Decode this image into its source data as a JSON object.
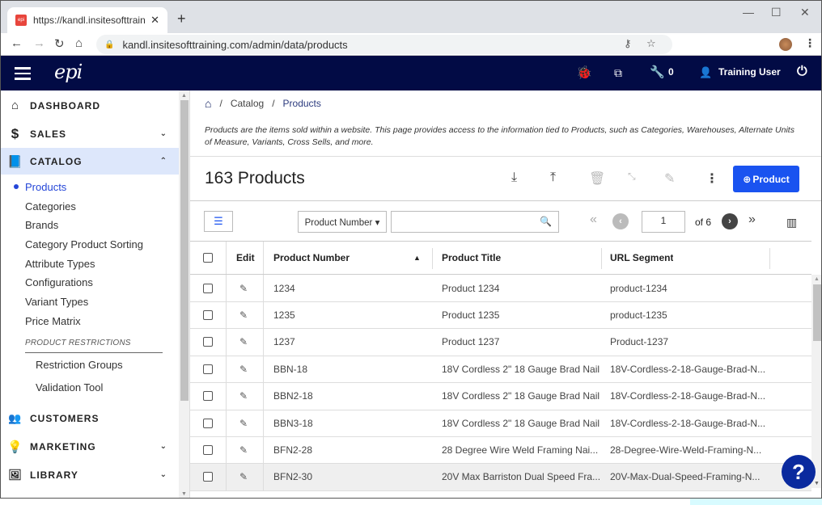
{
  "browser": {
    "tab_title": "https://kandl.insitesofttraining.com",
    "url": "kandl.insitesofttraining.com/admin/data/products",
    "icons": {
      "back": "arrow-left",
      "forward": "arrow-right",
      "reload": "reload",
      "home": "home",
      "lock": "lock",
      "key": "key",
      "star": "star",
      "minimize": "minimize",
      "maximize": "maximize",
      "close": "close"
    }
  },
  "topbar": {
    "logo": "epi",
    "wrench_count": "0",
    "user_name": "Training User",
    "icons": [
      "bug-icon",
      "open-external-icon",
      "wrench-icon",
      "user-icon",
      "power-icon"
    ]
  },
  "sidebar": {
    "sections": [
      {
        "label": "DASHBOARD",
        "icon": "home"
      },
      {
        "label": "SALES",
        "icon": "dollar",
        "chevron": "down"
      },
      {
        "label": "CATALOG",
        "icon": "book",
        "chevron": "up",
        "active": true
      },
      {
        "label": "CUSTOMERS",
        "icon": "people"
      },
      {
        "label": "MARKETING",
        "icon": "lightbulb",
        "chevron": "down"
      },
      {
        "label": "LIBRARY",
        "icon": "photo-library",
        "chevron": "down"
      }
    ],
    "catalog_items": [
      "Products",
      "Categories",
      "Brands",
      "Category Product Sorting",
      "Attribute Types",
      "Configurations",
      "Variant Types",
      "Price Matrix"
    ],
    "group_label": "PRODUCT RESTRICTIONS",
    "group_items": [
      "Restriction Groups",
      "Validation Tool"
    ]
  },
  "main": {
    "breadcrumb": {
      "sep": "/",
      "items": [
        "Catalog",
        "Products"
      ]
    },
    "description": "Products are the items sold within a website. This page provides access to the information tied to Products, such as Categories, Warehouses, Alternate Units of Measure, Variants, Cross Sells, and more.",
    "title": "163 Products",
    "add_button": "Product",
    "filter": {
      "field": "Product Number ▾",
      "search_value": ""
    },
    "pagination": {
      "page": "1",
      "of_label": "of 6"
    },
    "table": {
      "headers": {
        "edit": "Edit",
        "product_number": "Product Number",
        "product_title": "Product Title",
        "url_segment": "URL Segment"
      },
      "rows": [
        {
          "number": "1234",
          "title": "Product 1234",
          "url": "product-1234"
        },
        {
          "number": "1235",
          "title": "Product 1235",
          "url": "product-1235"
        },
        {
          "number": "1237",
          "title": "Product 1237",
          "url": "Product-1237"
        },
        {
          "number": "BBN-18",
          "title": "18V Cordless 2\" 18 Gauge Brad Nail...",
          "url": "18V-Cordless-2-18-Gauge-Brad-N..."
        },
        {
          "number": "BBN2-18",
          "title": "18V Cordless 2\" 18 Gauge Brad Nail...",
          "url": "18V-Cordless-2-18-Gauge-Brad-N..."
        },
        {
          "number": "BBN3-18",
          "title": "18V Cordless 2\" 18 Gauge Brad Nail...",
          "url": "18V-Cordless-2-18-Gauge-Brad-N..."
        },
        {
          "number": "BFN2-28",
          "title": "28 Degree Wire Weld Framing Nai...",
          "url": "28-Degree-Wire-Weld-Framing-N..."
        },
        {
          "number": "BFN2-30",
          "title": "20V Max Barriston Dual Speed Fra...",
          "url": "20V-Max-Dual-Speed-Framing-N..."
        }
      ]
    },
    "help": "?"
  },
  "colors": {
    "topbar": "#020b45",
    "accent": "#1a53f0",
    "active_bg": "#dde7fb",
    "active_text": "#2446d8"
  }
}
